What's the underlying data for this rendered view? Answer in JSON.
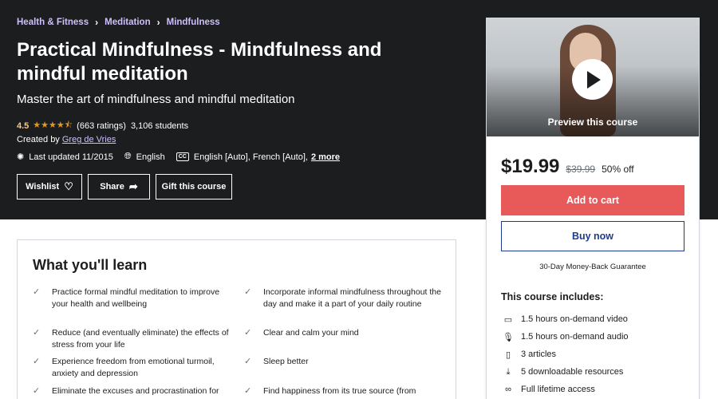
{
  "breadcrumb": [
    "Health & Fitness",
    "Meditation",
    "Mindfulness"
  ],
  "course": {
    "title": "Practical Mindfulness - Mindfulness and mindful meditation",
    "subtitle": "Master the art of mindfulness and mindful meditation",
    "rating": "4.5",
    "stars": "★★★★⯪",
    "rating_count": "(663 ratings)",
    "students": "3,106 students",
    "created_by_label": "Created by",
    "instructor": "Greg de Vries",
    "last_updated": "Last updated 11/2015",
    "language": "English",
    "captions": "English [Auto], French [Auto],",
    "captions_more": "2 more"
  },
  "actions": {
    "wishlist": "Wishlist",
    "share": "Share",
    "gift": "Gift this course"
  },
  "sidebar": {
    "preview_label": "Preview this course",
    "price": "$19.99",
    "original_price": "$39.99",
    "discount": "50% off",
    "add_to_cart": "Add to cart",
    "buy_now": "Buy now",
    "guarantee": "30-Day Money-Back Guarantee",
    "includes_title": "This course includes:",
    "includes": [
      {
        "icon": "video-icon",
        "text": "1.5 hours on-demand video"
      },
      {
        "icon": "audio-icon",
        "text": "1.5 hours on-demand audio"
      },
      {
        "icon": "file-icon",
        "text": "3 articles"
      },
      {
        "icon": "download-icon",
        "text": "5 downloadable resources"
      },
      {
        "icon": "infinity-icon",
        "text": "Full lifetime access"
      }
    ]
  },
  "learn": {
    "title": "What you'll learn",
    "items": [
      "Practice formal mindful meditation to improve your health and wellbeing",
      "Incorporate informal mindfulness throughout the day and make it a part of your daily routine",
      "Reduce (and eventually eliminate) the effects of stress from your life",
      "Clear and calm your mind",
      "Experience freedom from emotional turmoil, anxiety and depression",
      "Sleep better",
      "Eliminate the excuses and procrastination for",
      "Find happiness from its true source (from"
    ]
  },
  "colors": {
    "hero_bg": "#1c1d1f",
    "breadcrumb_link": "#cec0fc",
    "star": "#e59819",
    "cart_button": "#e85a5a",
    "buy_button_border": "#1c3d8f"
  }
}
